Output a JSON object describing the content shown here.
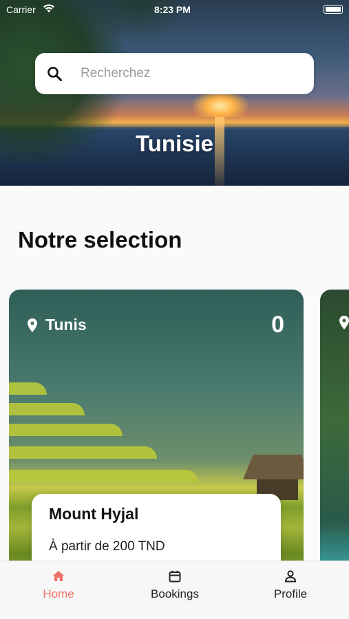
{
  "status_bar": {
    "carrier": "Carrier",
    "time": "8:23 PM"
  },
  "search": {
    "placeholder": "Recherchez"
  },
  "hero": {
    "title": "Tunisie"
  },
  "section": {
    "title": "Notre selection"
  },
  "cards": [
    {
      "location": "Tunis",
      "count": "0",
      "name": "Mount Hyjal",
      "price": "À partir de 200 TND"
    }
  ],
  "tabbar": {
    "active_color": "#f07167",
    "items": [
      {
        "label": "Home",
        "icon": "home-icon"
      },
      {
        "label": "Bookings",
        "icon": "calendar-icon"
      },
      {
        "label": "Profile",
        "icon": "person-icon"
      }
    ]
  }
}
